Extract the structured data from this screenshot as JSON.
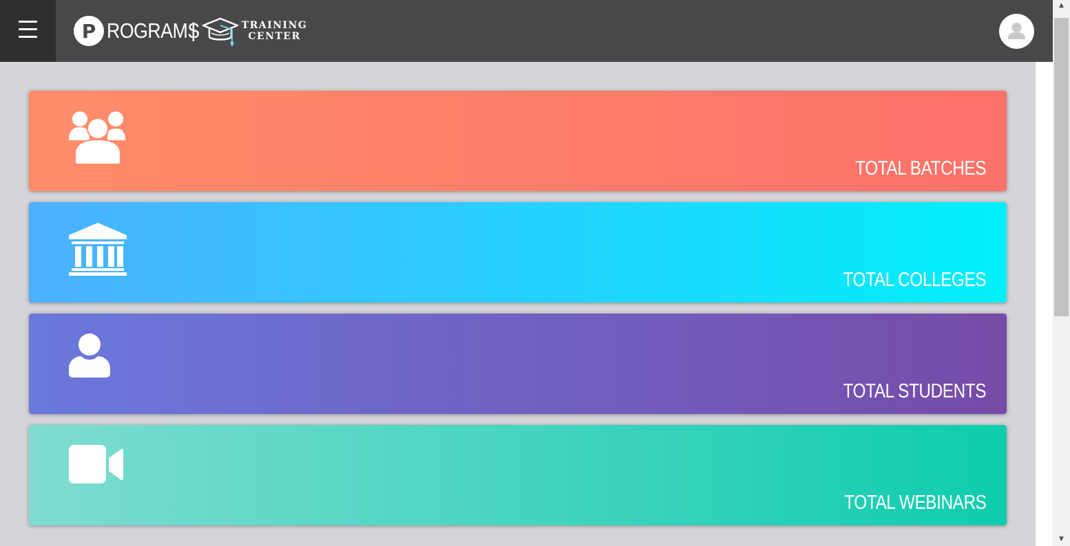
{
  "header": {
    "logo_letter": "P",
    "logo_word": "ROGRAMS",
    "logo_separator": "|",
    "logo_sub_line1": "TRAINING",
    "logo_sub_line2": "CENTER",
    "menu_icon": "hamburger-icon",
    "avatar_icon": "user-avatar-icon"
  },
  "cards": [
    {
      "label": "TOTAL BATCHES",
      "icon": "users-group-icon",
      "colors": [
        "#ff8d6a",
        "#ff716a"
      ]
    },
    {
      "label": "TOTAL COLLEGES",
      "icon": "university-icon",
      "colors": [
        "#4db0ff",
        "#00f0fb"
      ]
    },
    {
      "label": "TOTAL STUDENTS",
      "icon": "user-icon",
      "colors": [
        "#6a78dc",
        "#764ba8"
      ]
    },
    {
      "label": "TOTAL WEBINARS",
      "icon": "video-camera-icon",
      "colors": [
        "#7fdcd2",
        "#0ecdad"
      ]
    }
  ],
  "colors": {
    "header_bg": "#48484a",
    "menu_bg": "#2f2f30",
    "page_bg": "#d4d4d9"
  }
}
